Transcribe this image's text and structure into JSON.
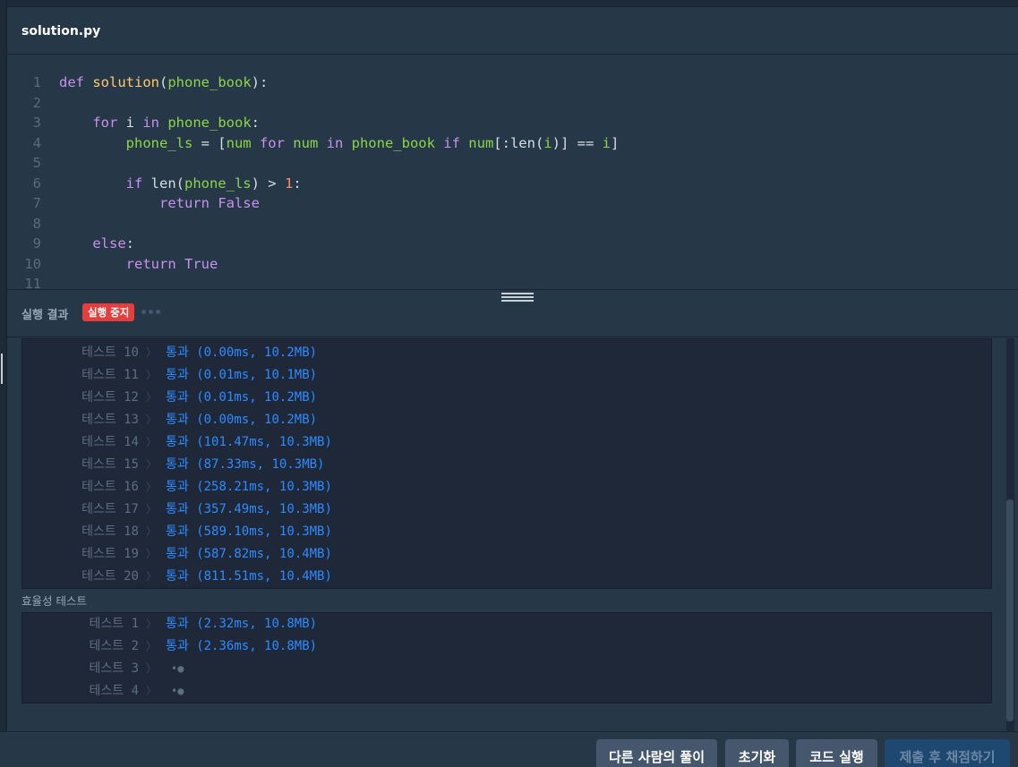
{
  "file": {
    "name": "solution.py"
  },
  "editor": {
    "line_numbers": [
      "1",
      "2",
      "3",
      "4",
      "5",
      "6",
      "7",
      "8",
      "9",
      "10",
      "11"
    ],
    "lines": [
      [
        [
          "kw",
          "def "
        ],
        [
          "fn",
          "solution"
        ],
        [
          "pl",
          "("
        ],
        [
          "var",
          "phone_book"
        ],
        [
          "pl",
          "):"
        ]
      ],
      [],
      [
        [
          "pl",
          "    "
        ],
        [
          "kw",
          "for "
        ],
        [
          "pl",
          "i "
        ],
        [
          "kw",
          "in "
        ],
        [
          "var",
          "phone_book"
        ],
        [
          "pl",
          ":"
        ]
      ],
      [
        [
          "pl",
          "        "
        ],
        [
          "var",
          "phone_ls"
        ],
        [
          "pl",
          " = ["
        ],
        [
          "var",
          "num "
        ],
        [
          "kw",
          "for "
        ],
        [
          "var",
          "num "
        ],
        [
          "kw",
          "in "
        ],
        [
          "var",
          "phone_book "
        ],
        [
          "kw",
          "if "
        ],
        [
          "var",
          "num"
        ],
        [
          "pl",
          "[:len("
        ],
        [
          "var",
          "i"
        ],
        [
          "pl",
          ")] == "
        ],
        [
          "var",
          "i"
        ],
        [
          "pl",
          "]"
        ]
      ],
      [],
      [
        [
          "pl",
          "        "
        ],
        [
          "kw",
          "if "
        ],
        [
          "pl",
          "len("
        ],
        [
          "var",
          "phone_ls"
        ],
        [
          "pl",
          ") > "
        ],
        [
          "num",
          "1"
        ],
        [
          "pl",
          ":"
        ]
      ],
      [
        [
          "pl",
          "            "
        ],
        [
          "kw",
          "return "
        ],
        [
          "kw",
          "False"
        ]
      ],
      [],
      [
        [
          "pl",
          "    "
        ],
        [
          "kw",
          "else"
        ],
        [
          "pl",
          ":"
        ]
      ],
      [
        [
          "pl",
          "        "
        ],
        [
          "kw",
          "return "
        ],
        [
          "kw",
          "True"
        ]
      ],
      []
    ]
  },
  "result": {
    "title": "실행 결과",
    "stop_label": "실행 중지",
    "accuracy_tests": [
      {
        "label": "테스트 10",
        "result": "통과 (0.00ms, 10.2MB)"
      },
      {
        "label": "테스트 11",
        "result": "통과 (0.01ms, 10.1MB)"
      },
      {
        "label": "테스트 12",
        "result": "통과 (0.01ms, 10.2MB)"
      },
      {
        "label": "테스트 13",
        "result": "통과 (0.00ms, 10.2MB)"
      },
      {
        "label": "테스트 14",
        "result": "통과 (101.47ms, 10.3MB)"
      },
      {
        "label": "테스트 15",
        "result": "통과 (87.33ms, 10.3MB)"
      },
      {
        "label": "테스트 16",
        "result": "통과 (258.21ms, 10.3MB)"
      },
      {
        "label": "테스트 17",
        "result": "통과 (357.49ms, 10.3MB)"
      },
      {
        "label": "테스트 18",
        "result": "통과 (589.10ms, 10.3MB)"
      },
      {
        "label": "테스트 19",
        "result": "통과 (587.82ms, 10.4MB)"
      },
      {
        "label": "테스트 20",
        "result": "통과 (811.51ms, 10.4MB)"
      }
    ],
    "efficiency_title": "효율성  테스트",
    "efficiency_tests": [
      {
        "label": "테스트 1",
        "result": "통과 (2.32ms, 10.8MB)",
        "pending": false
      },
      {
        "label": "테스트 2",
        "result": "통과 (2.36ms, 10.8MB)",
        "pending": false
      },
      {
        "label": "테스트 3",
        "result": "",
        "pending": true
      },
      {
        "label": "테스트 4",
        "result": "",
        "pending": true
      }
    ],
    "chevron": "〉",
    "pending_glyph": "•●"
  },
  "footer": {
    "others_label": "다른 사람의 풀이",
    "reset_label": "초기화",
    "run_label": "코드 실행",
    "submit_label": "제출 후 채점하기"
  },
  "colors": {
    "background": "#263747",
    "pass": "#2e8bff",
    "stop": "#e53e3e",
    "button": "#44576c",
    "submit": "#1f4870"
  }
}
